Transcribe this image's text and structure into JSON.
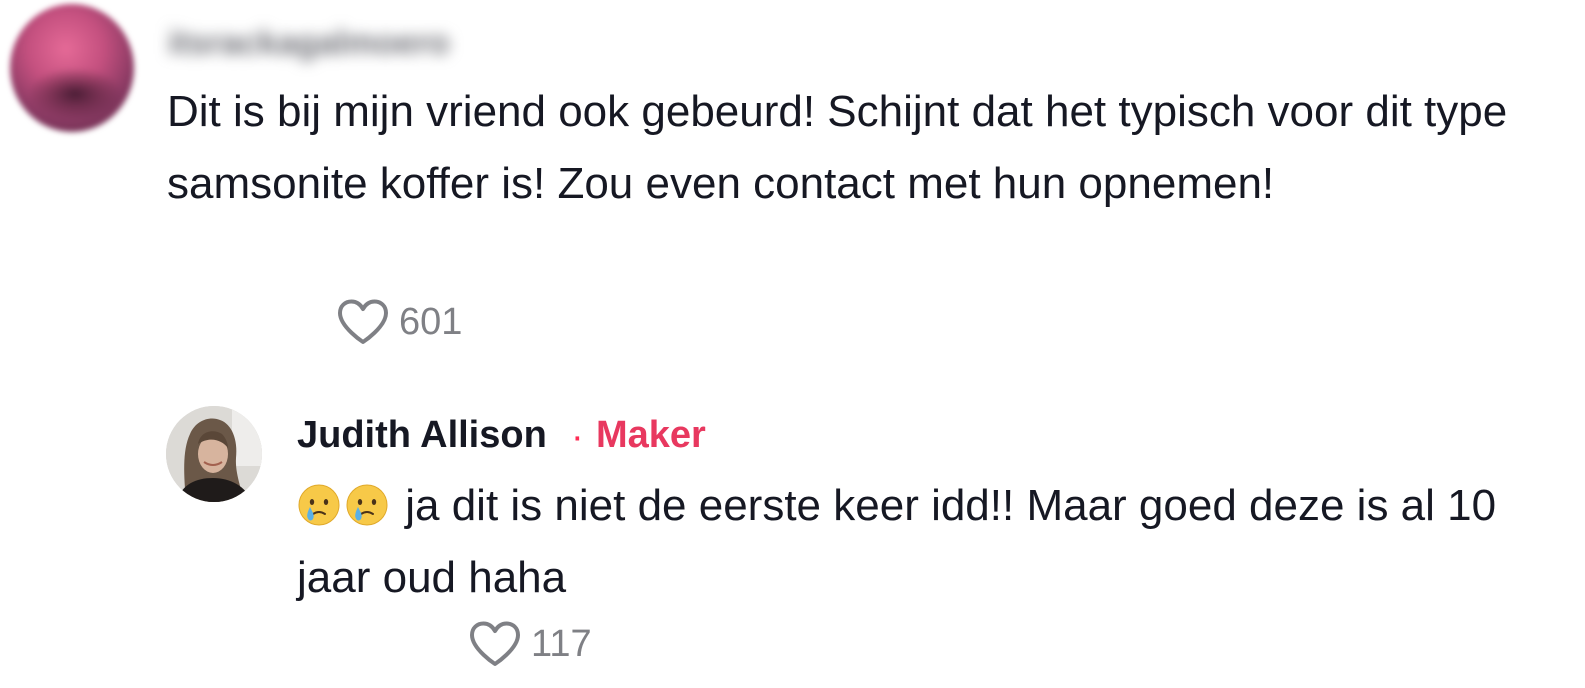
{
  "comment": {
    "author_name_blurred": "itsrackagalmoero",
    "text": "Dit is bij mijn vriend ook gebeurd! Schijnt dat het typisch voor dit type samsonite koffer is! Zou even contact met hun opnemen!",
    "likes": "601"
  },
  "reply": {
    "author_name": "Judith Allison",
    "separator": "·",
    "badge": "Maker",
    "emojis": [
      "crying-face-emoji",
      "crying-face-emoji"
    ],
    "text": "ja dit is niet de eerste keer idd!! Maar goed deze is al 10 jaar oud haha",
    "likes": "117"
  },
  "colors": {
    "maker_badge": "#e8385f",
    "text": "#161823",
    "muted": "#7f8085"
  }
}
